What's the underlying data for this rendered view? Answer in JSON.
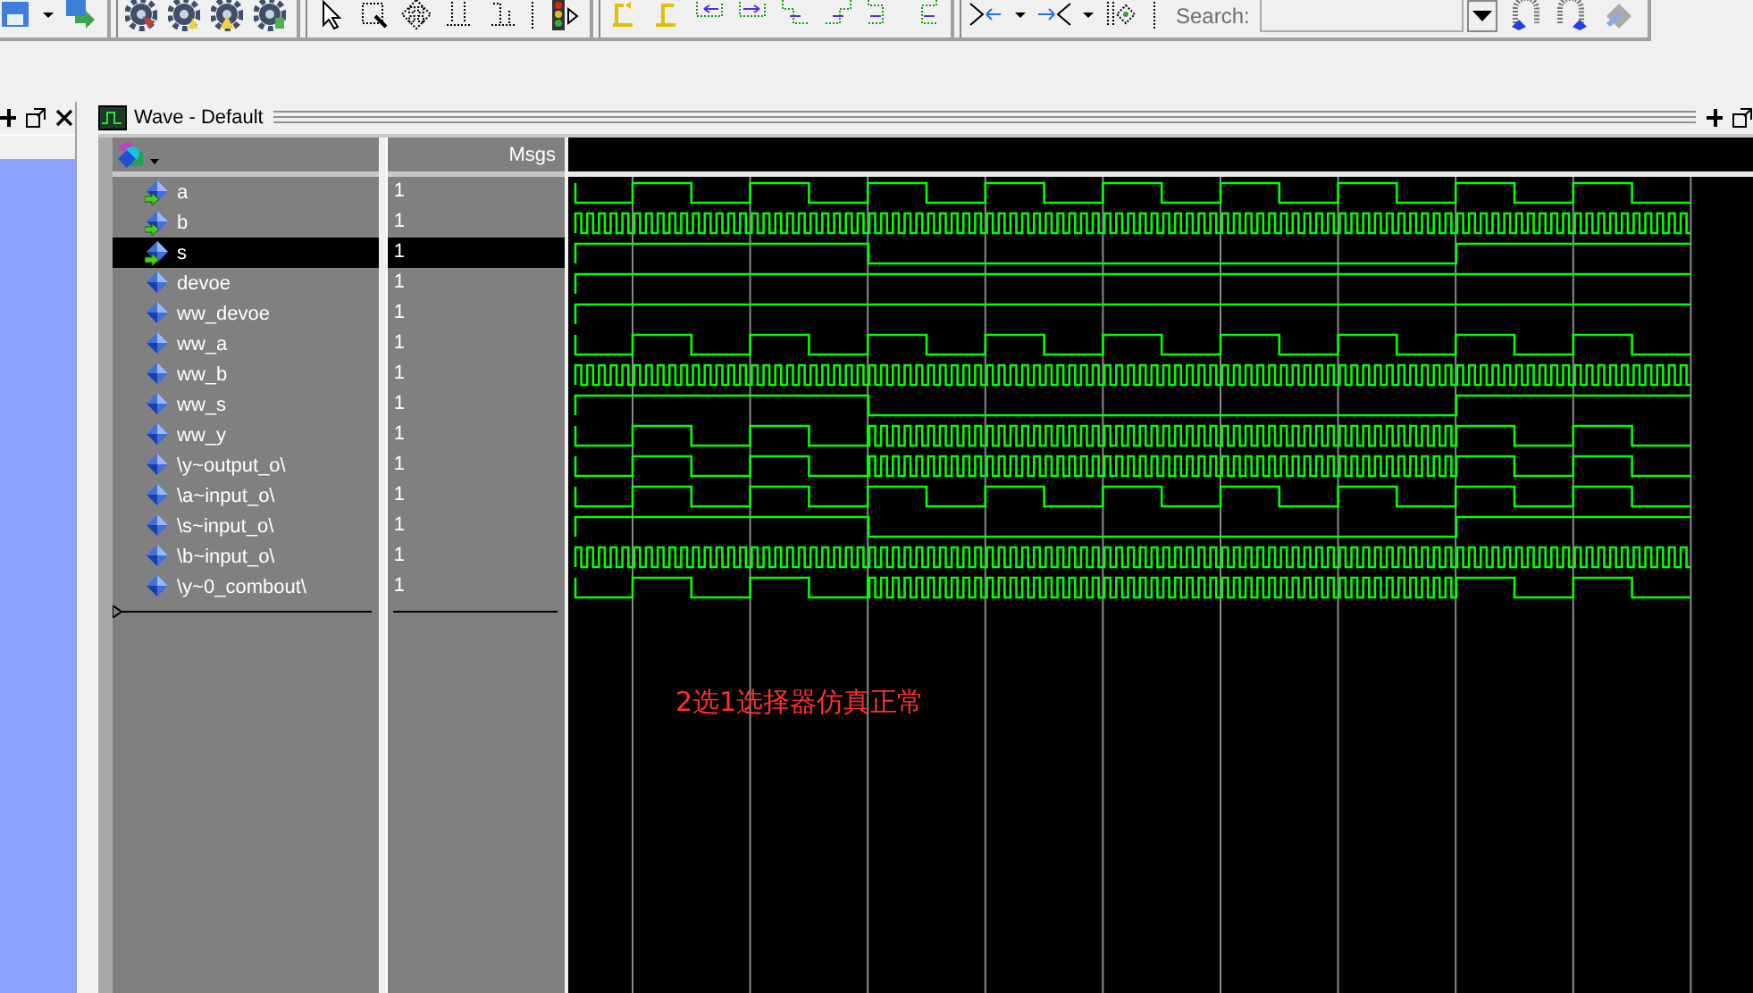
{
  "toolbar": {
    "search": {
      "label": "Search:"
    }
  },
  "window": {
    "title": "Wave - Default"
  },
  "columns": {
    "msgs": "Msgs"
  },
  "signals": [
    {
      "name": "a",
      "value": "1",
      "input": true,
      "selected": false,
      "kind": "slow"
    },
    {
      "name": "b",
      "value": "1",
      "input": true,
      "selected": false,
      "kind": "fast"
    },
    {
      "name": "s",
      "value": "1",
      "input": true,
      "selected": true,
      "kind": "select"
    },
    {
      "name": "devoe",
      "value": "1",
      "input": false,
      "selected": false,
      "kind": "constant"
    },
    {
      "name": "ww_devoe",
      "value": "1",
      "input": false,
      "selected": false,
      "kind": "constant"
    },
    {
      "name": "ww_a",
      "value": "1",
      "input": false,
      "selected": false,
      "kind": "slow"
    },
    {
      "name": "ww_b",
      "value": "1",
      "input": false,
      "selected": false,
      "kind": "fast"
    },
    {
      "name": "ww_s",
      "value": "1",
      "input": false,
      "selected": false,
      "kind": "select"
    },
    {
      "name": "ww_y",
      "value": "1",
      "input": false,
      "selected": false,
      "kind": "mux"
    },
    {
      "name": "\\y~output_o\\",
      "value": "1",
      "input": false,
      "selected": false,
      "kind": "mux"
    },
    {
      "name": "\\a~input_o\\",
      "value": "1",
      "input": false,
      "selected": false,
      "kind": "slow"
    },
    {
      "name": "\\s~input_o\\",
      "value": "1",
      "input": false,
      "selected": false,
      "kind": "select"
    },
    {
      "name": "\\b~input_o\\",
      "value": "1",
      "input": false,
      "selected": false,
      "kind": "fast"
    },
    {
      "name": "\\y~0_combout\\",
      "value": "1",
      "input": false,
      "selected": false,
      "kind": "mux"
    }
  ],
  "annotation": "2选1选择器仿真正常"
}
